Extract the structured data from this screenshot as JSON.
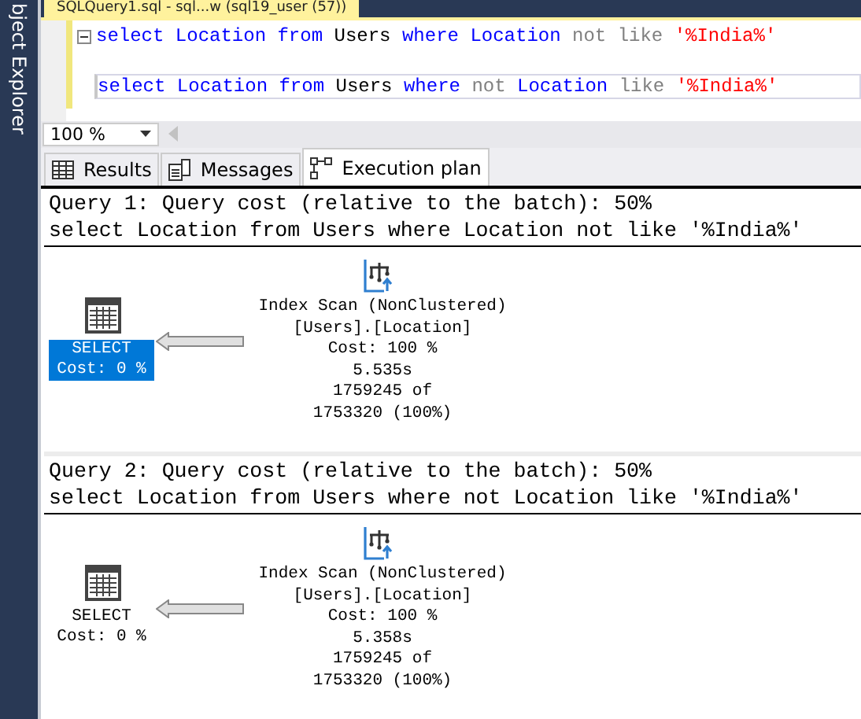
{
  "document_tab": {
    "title": "SQLQuery1.sql - sql...w (sql19_user (57))"
  },
  "sidebar": {
    "label": "bject Explorer"
  },
  "editor": {
    "lines": [
      {
        "current": false,
        "foldable": true,
        "tokens": [
          {
            "text": "select",
            "kind": "keyword"
          },
          {
            "text": "Location",
            "kind": "keyword"
          },
          {
            "text": "from",
            "kind": "keyword"
          },
          {
            "text": "Users",
            "kind": "identifier"
          },
          {
            "text": "where",
            "kind": "keyword"
          },
          {
            "text": "Location",
            "kind": "keyword"
          },
          {
            "text": "not",
            "kind": "operator"
          },
          {
            "text": "like",
            "kind": "operator"
          },
          {
            "text": "'%India%'",
            "kind": "string"
          }
        ]
      },
      {
        "current": true,
        "foldable": false,
        "tokens": [
          {
            "text": "select",
            "kind": "keyword"
          },
          {
            "text": "Location",
            "kind": "keyword"
          },
          {
            "text": "from",
            "kind": "keyword"
          },
          {
            "text": "Users",
            "kind": "identifier"
          },
          {
            "text": "where",
            "kind": "keyword"
          },
          {
            "text": "not",
            "kind": "operator"
          },
          {
            "text": "Location",
            "kind": "keyword"
          },
          {
            "text": "like",
            "kind": "operator"
          },
          {
            "text": "'%India%'",
            "kind": "string"
          }
        ]
      }
    ]
  },
  "zoom": {
    "value": "100 %"
  },
  "tabs": [
    {
      "label": "Results",
      "kind": "results",
      "selected": false
    },
    {
      "label": "Messages",
      "kind": "messages",
      "selected": false
    },
    {
      "label": "Execution plan",
      "kind": "plan",
      "selected": true
    }
  ],
  "queries": [
    {
      "header": "Query 1: Query cost (relative to the batch): 50%",
      "sql": "select Location from Users where Location not like '%India%'",
      "select_node": {
        "label": "SELECT",
        "cost": "Cost: 0 %",
        "selected": true
      },
      "scan_node": {
        "lines": [
          "Index Scan (NonClustered)",
          "[Users].[Location]",
          "Cost: 100 %",
          "5.535s",
          "1759245 of",
          "1753320 (100%)"
        ]
      }
    },
    {
      "header": "Query 2: Query cost (relative to the batch): 50%",
      "sql": "select Location from Users where not Location like '%India%'",
      "select_node": {
        "label": "SELECT",
        "cost": "Cost: 0 %",
        "selected": false
      },
      "scan_node": {
        "lines": [
          "Index Scan (NonClustered)",
          "[Users].[Location]",
          "Cost: 100 %",
          "5.358s",
          "1759245 of",
          "1753320 (100%)"
        ]
      }
    }
  ]
}
